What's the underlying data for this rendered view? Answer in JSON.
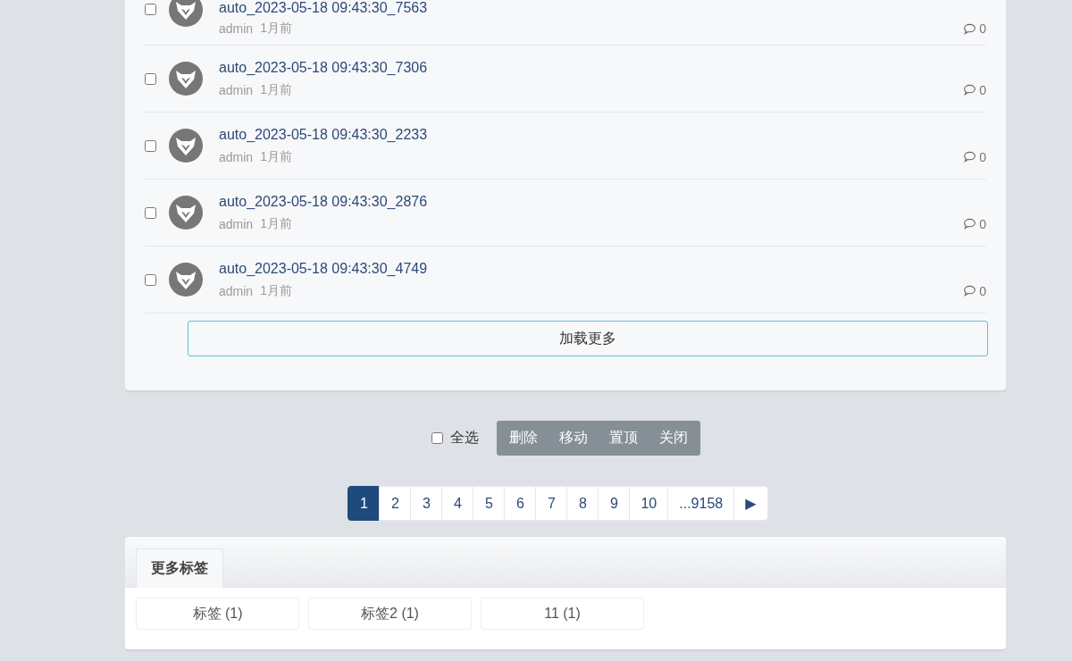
{
  "threads": [
    {
      "title": "auto_2023-05-18 09:43:30_7563",
      "author": "admin",
      "time": "1月前",
      "comments": "0",
      "checked": false
    },
    {
      "title": "auto_2023-05-18 09:43:30_7306",
      "author": "admin",
      "time": "1月前",
      "comments": "0",
      "checked": false
    },
    {
      "title": "auto_2023-05-18 09:43:30_2233",
      "author": "admin",
      "time": "1月前",
      "comments": "0",
      "checked": false
    },
    {
      "title": "auto_2023-05-18 09:43:30_2876",
      "author": "admin",
      "time": "1月前",
      "comments": "0",
      "checked": false
    },
    {
      "title": "auto_2023-05-18 09:43:30_4749",
      "author": "admin",
      "time": "1月前",
      "comments": "0",
      "checked": false
    }
  ],
  "load_more": "加载更多",
  "select_all": {
    "label": "全选",
    "checked": false
  },
  "actions": [
    "删除",
    "移动",
    "置顶",
    "关闭"
  ],
  "pagination": [
    {
      "label": "1",
      "selected": true
    },
    {
      "label": "2",
      "selected": false
    },
    {
      "label": "3",
      "selected": false
    },
    {
      "label": "4",
      "selected": false
    },
    {
      "label": "5",
      "selected": false
    },
    {
      "label": "6",
      "selected": false
    },
    {
      "label": "7",
      "selected": false
    },
    {
      "label": "8",
      "selected": false
    },
    {
      "label": "9",
      "selected": false
    },
    {
      "label": "10",
      "selected": false
    },
    {
      "label": "...9158",
      "selected": false
    },
    {
      "label": "▶",
      "selected": false
    }
  ],
  "tags_panel": {
    "tabs": [
      {
        "label": "更多标签",
        "selected": true
      }
    ],
    "tags": [
      "标签 (1)",
      "标签2 (1)",
      "11 (1)"
    ]
  }
}
